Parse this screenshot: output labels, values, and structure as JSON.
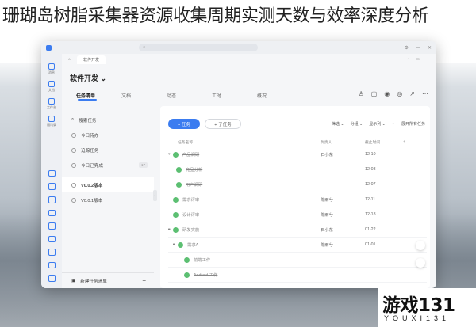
{
  "headline": "珊瑚岛树脂采集器资源收集周期实测天数与效率深度分析",
  "window": {
    "titlebar": {
      "app": "",
      "search_placeholder": ""
    },
    "subbar": {
      "tab_label": "软件开发"
    },
    "rail": [
      {
        "label": "消息"
      },
      {
        "label": "文档"
      },
      {
        "label": "工作台"
      },
      {
        "label": "通讯录"
      }
    ],
    "project": {
      "title": "软件开发 ⌄"
    },
    "tabs": [
      "任务清单",
      "文档",
      "动态",
      "工时",
      "概况"
    ],
    "sidebar": {
      "items": [
        {
          "label": "搜索任务",
          "count": ""
        },
        {
          "label": "今日待办",
          "count": ""
        },
        {
          "label": "追踪任务",
          "count": ""
        },
        {
          "label": "今日已完成",
          "count": "17"
        },
        {
          "label": "V0.0.2版本",
          "count": ""
        },
        {
          "label": "V0.0.1版本",
          "count": ""
        }
      ],
      "footer": "新建任务清单",
      "footer_plus": "+"
    },
    "toolbar": {
      "add_task": "+ 任务",
      "add_subtask": "+ 子任务",
      "filters": [
        "筛选 ⌄",
        "分组 ⌄",
        "显示列 ⌄",
        "⌄",
        "展开所有任务"
      ]
    },
    "table": {
      "headers": [
        "任务名称",
        "负责人",
        "截止时间",
        "+"
      ],
      "rows": [
        {
          "arrow": "▾",
          "name": "产品调研",
          "owner": "石小东",
          "due": "12-10"
        },
        {
          "arrow": "",
          "name": "竞品分析",
          "owner": "",
          "due": "12-03"
        },
        {
          "arrow": "",
          "name": "用户调研",
          "owner": "",
          "due": "12-07"
        },
        {
          "arrow": "",
          "name": "需求评审",
          "owner": "陈雨兮",
          "due": "12-11"
        },
        {
          "arrow": "",
          "name": "设计评审",
          "owner": "陈雨兮",
          "due": "12-18"
        },
        {
          "arrow": "▾",
          "name": "研发实施",
          "owner": "石小东",
          "due": "01-22"
        },
        {
          "arrow": "▾",
          "name": "需求A",
          "owner": "陈雨兮",
          "due": "01-01"
        },
        {
          "arrow": "",
          "name": "前端工作",
          "owner": "",
          "due": ""
        },
        {
          "arrow": "",
          "name": "Android 工作",
          "owner": "",
          "due": ""
        }
      ]
    }
  },
  "watermark": {
    "title": "游戏131",
    "subtitle": "YOUXI131"
  }
}
